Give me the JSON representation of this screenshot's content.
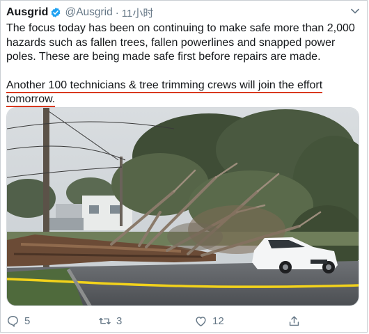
{
  "tweet": {
    "author_name": "Ausgrid",
    "author_handle": "@Ausgrid",
    "separator": "·",
    "timestamp": "11小时",
    "paragraph1": "The focus today has been on continuing to make safe more than 2,000 hazards such as fallen trees, fallen powerlines and snapped power poles. These are being made safe first before repairs are made.",
    "paragraph2_line1": "Another 100 technicians & tree trimming crews will join the effort",
    "paragraph2_line2": "tomorrow.",
    "image_icon": "photo-fallen-tree-on-car"
  },
  "actions": {
    "reply_count": "5",
    "retweet_count": "3",
    "like_count": "12",
    "reply_icon": "reply-icon",
    "retweet_icon": "retweet-icon",
    "like_icon": "heart-icon",
    "share_icon": "share-icon"
  },
  "colors": {
    "text": "#14171a",
    "secondary": "#657786",
    "verified": "#1da1f2",
    "underline": "#d9381e",
    "tape": "#f2d21b"
  }
}
